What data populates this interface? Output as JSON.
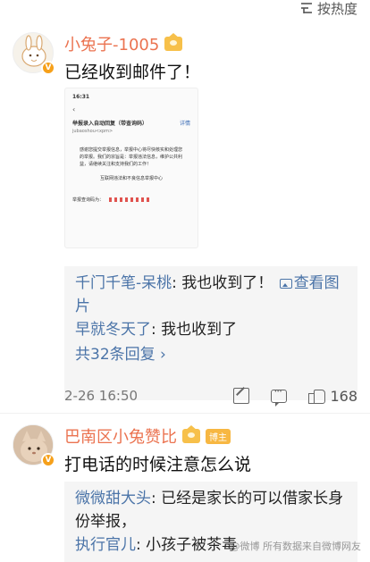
{
  "sort": {
    "label": "按热度"
  },
  "comments": [
    {
      "username": "小兔子-1005",
      "text": "已经收到邮件了！",
      "attachment": {
        "time": "16:31",
        "back": "‹",
        "subject": "举报录入自动回复（带查询码）",
        "subject_link": "详情",
        "from": "jubaoshou<xpm>",
        "body": "感谢您提交举报信息，举报中心将尽快核实和处理您的举报。我们的宗旨是：举报违法信息，维护公共利益，请继续关注和支持我们的工作！",
        "sign": "互联网违法和不良信息举报中心",
        "query_label": "举报查询码为："
      },
      "replies": [
        {
          "name": "千门千笔-呆桃",
          "text": "我也收到了！",
          "image_link": "查看图片"
        },
        {
          "name": "早就冬天了",
          "text": "我也收到了"
        }
      ],
      "more_replies": "共32条回复 ›",
      "time": "2-26 16:50",
      "likes": "168"
    },
    {
      "username": "巴南区小兔赞比",
      "owner_tag": "博主",
      "text": "打电话的时候注意怎么说",
      "replies": [
        {
          "name": "微微甜大头",
          "text": "已经是家长的可以借家长身份举报，"
        },
        {
          "name": "执行官儿",
          "text": "小孩子被茶毒"
        }
      ]
    }
  ],
  "watermark": "@微博 所有数据来自微博网友"
}
